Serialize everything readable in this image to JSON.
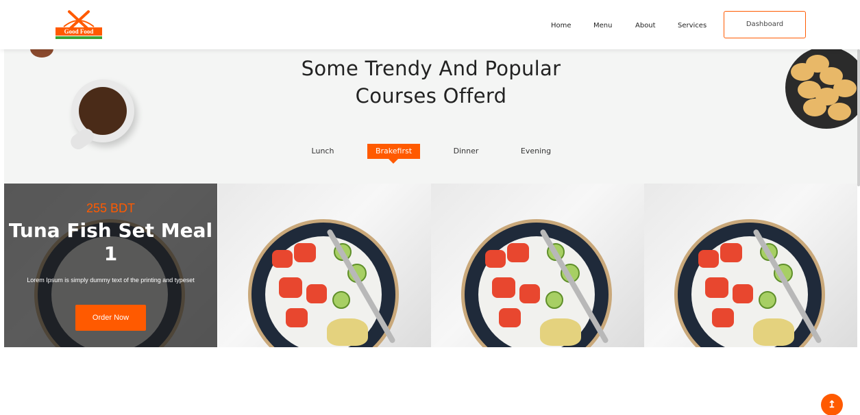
{
  "brand": {
    "logo_text": "Good Food",
    "accent": "#ff5a00",
    "stripe": "#3aa335"
  },
  "nav": {
    "items": [
      "Home",
      "Menu",
      "About",
      "Services"
    ],
    "dashboard_label": "Dashboard"
  },
  "courses": {
    "heading_line1": "Some Trendy And Popular",
    "heading_line2": "Courses Offerd",
    "tabs": [
      "Lunch",
      "Brakefirst",
      "Dinner",
      "Evening"
    ],
    "active_tab": "Brakefirst"
  },
  "featured": {
    "price": "255 BDT",
    "title": "Tuna Fish Set Meal 1",
    "description": "Lorem Ipsum is simply dummy text of the printing and typeset",
    "button_label": "Order Now"
  },
  "scroll_top_icon": "arrow-up-icon",
  "scroll_top_symbol": "↥"
}
